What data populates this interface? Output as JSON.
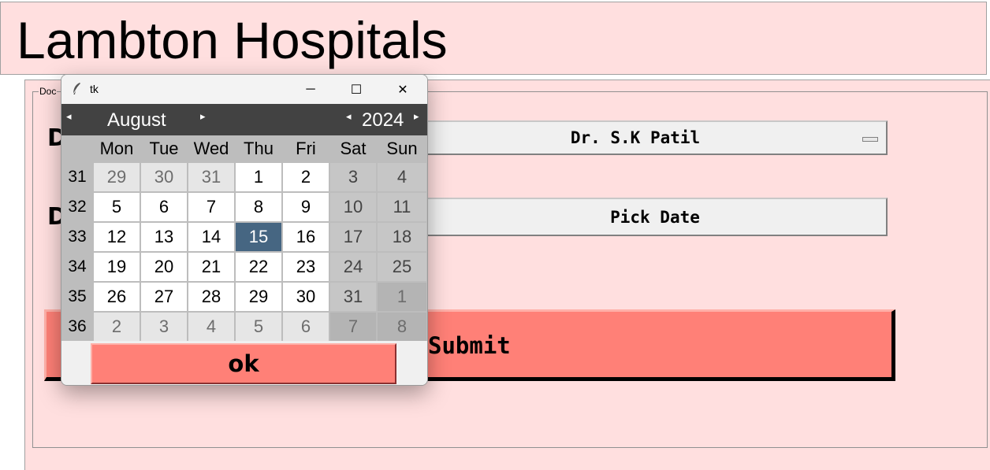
{
  "app": {
    "title": "Lambton Hospitals"
  },
  "form": {
    "frame_label": "Doc",
    "doctor_label": "D",
    "date_label": "D",
    "doctor_value": "Dr. S.K Patil",
    "pick_date_label": "Pick Date",
    "submit_label": "Submit"
  },
  "popup": {
    "window_title": "tk",
    "minimize": "─",
    "maximize": "☐",
    "close": "✕",
    "prev_month": "◂",
    "next_month": "▸",
    "prev_year": "◂",
    "next_year": "▸",
    "month": "August",
    "year": "2024",
    "ok_label": "ok"
  },
  "calendar": {
    "weekdays": [
      "Mon",
      "Tue",
      "Wed",
      "Thu",
      "Fri",
      "Sat",
      "Sun"
    ],
    "weeks": [
      {
        "num": "31",
        "days": [
          "29",
          "30",
          "31",
          "1",
          "2",
          "3",
          "4"
        ]
      },
      {
        "num": "32",
        "days": [
          "5",
          "6",
          "7",
          "8",
          "9",
          "10",
          "11"
        ]
      },
      {
        "num": "33",
        "days": [
          "12",
          "13",
          "14",
          "15",
          "16",
          "17",
          "18"
        ]
      },
      {
        "num": "34",
        "days": [
          "19",
          "20",
          "21",
          "22",
          "23",
          "24",
          "25"
        ]
      },
      {
        "num": "35",
        "days": [
          "26",
          "27",
          "28",
          "29",
          "30",
          "31",
          "1"
        ]
      },
      {
        "num": "36",
        "days": [
          "2",
          "3",
          "4",
          "5",
          "6",
          "7",
          "8"
        ]
      }
    ],
    "selected_day": "15",
    "colors": {
      "header_bg": "#424242",
      "selected_bg": "#466682",
      "accent": "#ff8077",
      "window_bg": "#ffdfdf"
    }
  }
}
